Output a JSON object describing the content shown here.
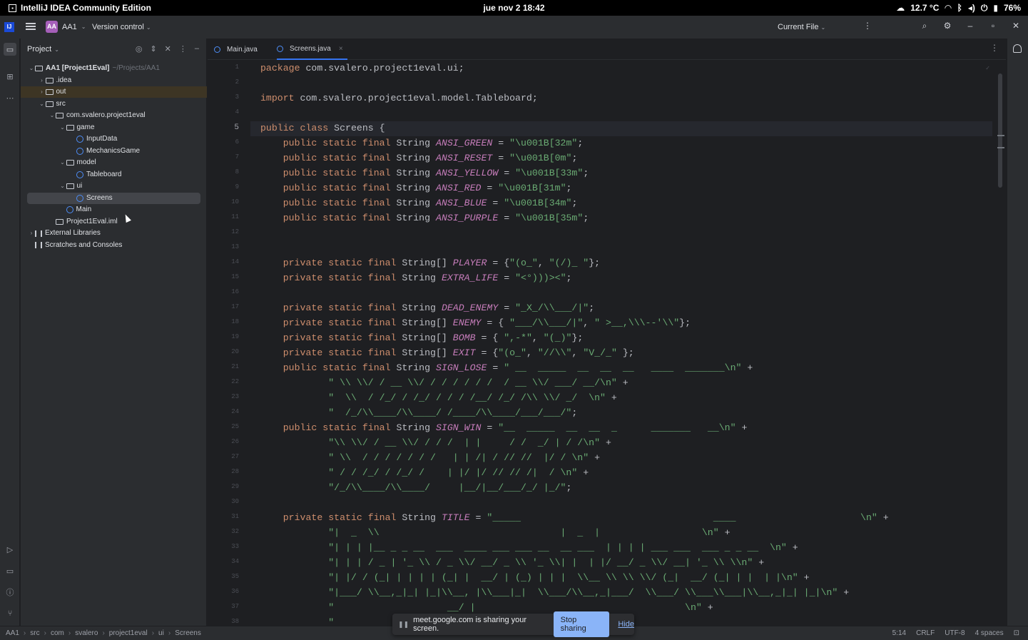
{
  "os": {
    "app_name": "IntelliJ IDEA Community Edition",
    "clock": "jue nov 2  18:42",
    "temperature": "12.7 °C",
    "battery": "76%"
  },
  "header": {
    "logo": "IJ",
    "project_badge": "AA",
    "project_name": "AA1",
    "version_control": "Version control",
    "run_config": "Current File"
  },
  "project_panel": {
    "title": "Project",
    "tree": [
      {
        "label": "AA1 [Project1Eval]",
        "path": "~/Projects/AA1",
        "icon": "folder",
        "indent": 0,
        "chev": "open"
      },
      {
        "label": ".idea",
        "icon": "folder",
        "indent": 1,
        "chev": "closed"
      },
      {
        "label": "out",
        "icon": "folder",
        "indent": 1,
        "chev": "closed",
        "highlight": true
      },
      {
        "label": "src",
        "icon": "folder",
        "indent": 1,
        "chev": "open"
      },
      {
        "label": "com.svalero.project1eval",
        "icon": "folder",
        "indent": 2,
        "chev": "open"
      },
      {
        "label": "game",
        "icon": "folder",
        "indent": 3,
        "chev": "open"
      },
      {
        "label": "InputData",
        "icon": "class",
        "indent": 4,
        "chev": ""
      },
      {
        "label": "MechanicsGame",
        "icon": "class",
        "indent": 4,
        "chev": ""
      },
      {
        "label": "model",
        "icon": "folder",
        "indent": 3,
        "chev": "open"
      },
      {
        "label": "Tableboard",
        "icon": "class",
        "indent": 4,
        "chev": ""
      },
      {
        "label": "ui",
        "icon": "folder",
        "indent": 3,
        "chev": "open"
      },
      {
        "label": "Screens",
        "icon": "class",
        "indent": 4,
        "chev": "",
        "selected": true
      },
      {
        "label": "Main",
        "icon": "class",
        "indent": 3,
        "chev": ""
      },
      {
        "label": "Project1Eval.iml",
        "icon": "file",
        "indent": 2,
        "chev": ""
      },
      {
        "label": "External Libraries",
        "icon": "lib",
        "indent": 0,
        "chev": "closed"
      },
      {
        "label": "Scratches and Consoles",
        "icon": "scratch",
        "indent": 0,
        "chev": ""
      }
    ]
  },
  "editor": {
    "tabs": [
      {
        "label": "Main.java",
        "active": false
      },
      {
        "label": "Screens.java",
        "active": true
      }
    ],
    "current_line_number": "5",
    "code": [
      {
        "text": "package com.svalero.project1eval.ui;"
      },
      {
        "text": ""
      },
      {
        "text": "import com.svalero.project1eval.model.Tableboard;"
      },
      {
        "text": ""
      },
      {
        "text": "public class Screens {"
      },
      {
        "text": "    public static final String ANSI_GREEN = \"\\u001B[32m\";"
      },
      {
        "text": "    public static final String ANSI_RESET = \"\\u001B[0m\";"
      },
      {
        "text": "    public static final String ANSI_YELLOW = \"\\u001B[33m\";"
      },
      {
        "text": "    public static final String ANSI_RED = \"\\u001B[31m\";"
      },
      {
        "text": "    public static final String ANSI_BLUE = \"\\u001B[34m\";"
      },
      {
        "text": "    public static final String ANSI_PURPLE = \"\\u001B[35m\";"
      },
      {
        "text": ""
      },
      {
        "text": ""
      },
      {
        "text": "    private static final String[] PLAYER = {\"(o_\", \"(/)_ \"};"
      },
      {
        "text": "    private static final String EXTRA_LIFE = \"<°)))><\";"
      },
      {
        "text": ""
      },
      {
        "text": "    private static final String DEAD_ENEMY = \"_X_/\\\\___/|\";"
      },
      {
        "text": "    private static final String[] ENEMY = { \"___/\\\\___/|\", \" >__,\\\\\\--'\\\\\"};"
      },
      {
        "text": "    private static final String[] BOMB = { \",-*\", \"(_)\"};"
      },
      {
        "text": "    private static final String[] EXIT = {\"(o_\", \"//\\\\\", \"V_/_\" };"
      },
      {
        "text": "    public static final String SIGN_LOSE = \" __  _____  __  __  __   ____  _______\\n\" +"
      },
      {
        "text": "            \" \\\\ \\\\/ / __ \\\\/ / / / / / /  / __ \\\\/ ___/ __/\\n\" +"
      },
      {
        "text": "            \"  \\\\  / /_/ / /_/ / / / /__/ /_/ /\\\\ \\\\/ _/  \\n\" +"
      },
      {
        "text": "            \"  /_/\\\\____/\\\\____/ /____/\\\\____/___/___/\";"
      },
      {
        "text": "    public static final String SIGN_WIN = \"__  _____  __  __  _      _______   __\\n\" +"
      },
      {
        "text": "            \"\\\\ \\\\/ / __ \\\\/ / / /  | |     / /  _/ | / /\\n\" +"
      },
      {
        "text": "            \" \\\\  / / / / / / /   | | /| / // //  |/ / \\n\" +"
      },
      {
        "text": "            \" / / /_/ / /_/ /    | |/ |/ // // /|  / \\n\" +"
      },
      {
        "text": "            \"/_/\\\\____/\\\\____/     |__/|__/___/_/ |_/\";"
      },
      {
        "text": ""
      },
      {
        "text": "    private static final String TITLE = \"_____                                  ____                      \\n\" +"
      },
      {
        "text": "            \"|  _  \\\\                                |  _  |                  \\n\" +"
      },
      {
        "text": "            \"| | | |__ _ _ __  ___  ____ ___ ___ __  __ ___  | | | | ___ ___  ___ _ _ __  \\n\" +"
      },
      {
        "text": "            \"| | | / _ | '_ \\\\ / _ \\\\/ __/ _ \\\\ '_ \\\\| |  | |/ __/ _ \\\\/ __| '_ \\\\ \\\\n\" +"
      },
      {
        "text": "            \"| |/ / (_| | | | | (_| |  __/ | (_) | | |  \\\\__ \\\\ \\\\ \\\\/ (_|  __/ (_| | |  | |\\n\" +"
      },
      {
        "text": "            \"|___/ \\\\__,_|_| |_|\\\\__, |\\\\___|_|  \\\\___/\\\\__,_|___/  \\\\___/ \\\\___\\\\___|\\\\__,_|_| |_|\\n\" +"
      },
      {
        "text": "            \"                    __/ |                                     \\n\" +"
      },
      {
        "text": "            \""
      }
    ]
  },
  "status_bar": {
    "crumbs": [
      "AA1",
      "src",
      "com",
      "svalero",
      "project1eval",
      "ui",
      "Screens"
    ],
    "position": "5:14",
    "line_sep": "CRLF",
    "encoding": "UTF-8",
    "indent": "4 spaces"
  },
  "share_banner": {
    "message": "meet.google.com is sharing your screen.",
    "stop_label": "Stop sharing",
    "hide_label": "Hide"
  }
}
